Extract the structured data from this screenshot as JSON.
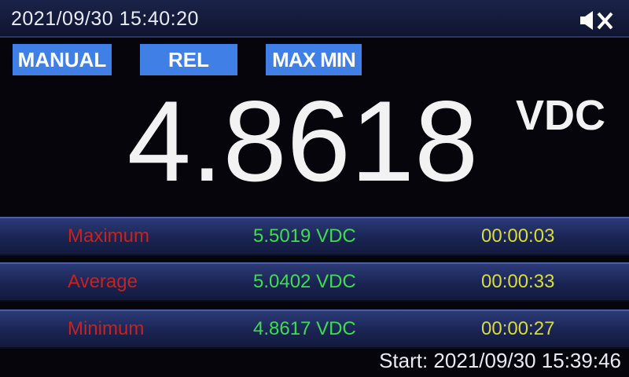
{
  "header": {
    "datetime": "2021/09/30  15:40:20",
    "icon": "speaker-muted-icon"
  },
  "modes": {
    "manual": "MANUAL",
    "rel": "REL",
    "maxmin": "MAX MIN"
  },
  "reading": {
    "value": "4.8618",
    "unit": "VDC"
  },
  "stats": [
    {
      "label": "Maximum",
      "value": "5.5019  VDC",
      "time": "00:00:03"
    },
    {
      "label": "Average",
      "value": "5.0402  VDC",
      "time": "00:00:33"
    },
    {
      "label": "Minimum",
      "value": "4.8617  VDC",
      "time": "00:00:27"
    }
  ],
  "start": "Start: 2021/09/30 15:39:46",
  "colors": {
    "background": "#05050b",
    "mode_button": "#3f7fe6",
    "label_red": "#c7221e",
    "value_green": "#3fdc52",
    "time_yellow": "#d8dc3a"
  }
}
